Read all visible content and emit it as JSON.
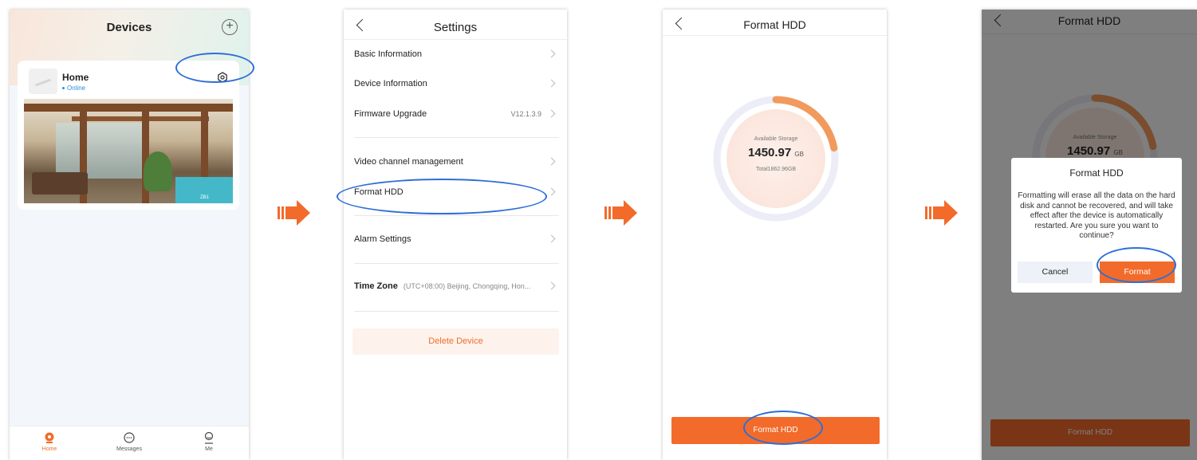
{
  "colors": {
    "accent": "#f26b2a",
    "highlight_ring": "#2e6fd6",
    "online": "#2a8ee0"
  },
  "devices_screen": {
    "title": "Devices",
    "add_icon": "plus-circle-icon",
    "device": {
      "name": "Home",
      "status": "Online",
      "settings_icon": "gear-icon",
      "preview_channel": "ZB1"
    },
    "tabs": [
      {
        "label": "Home",
        "icon": "home-camera-icon",
        "active": true
      },
      {
        "label": "Messages",
        "icon": "chat-bubble-icon",
        "active": false
      },
      {
        "label": "Me",
        "icon": "user-icon",
        "active": false
      }
    ]
  },
  "settings_screen": {
    "title": "Settings",
    "items": [
      {
        "label": "Basic Information"
      },
      {
        "label": "Device Information"
      },
      {
        "label": "Firmware Upgrade",
        "value": "V12.1.3.9"
      },
      {
        "label": "Video channel management"
      },
      {
        "label": "Format HDD"
      },
      {
        "label": "Alarm Settings"
      },
      {
        "label": "Time Zone",
        "value": "(UTC+08:00) Beijing, Chongqing, Hon..."
      }
    ],
    "delete_label": "Delete Device"
  },
  "format_screen": {
    "title": "Format HDD",
    "storage_label": "Available Storage",
    "available": "1450.97",
    "unit": "GB",
    "total": "Total1862.96GB",
    "used_fraction": 0.221,
    "button_label": "Format HDD"
  },
  "dialog_screen": {
    "title": "Format HDD",
    "storage_label": "Available Storage",
    "available": "1450.97",
    "unit": "GB",
    "button_label": "Format HDD",
    "dialog": {
      "title": "Format HDD",
      "message": "Formatting will erase all the data on the hard disk and cannot be recovered, and will take effect after the device is automatically restarted. Are you sure you want to continue?",
      "cancel_label": "Cancel",
      "confirm_label": "Format"
    }
  }
}
